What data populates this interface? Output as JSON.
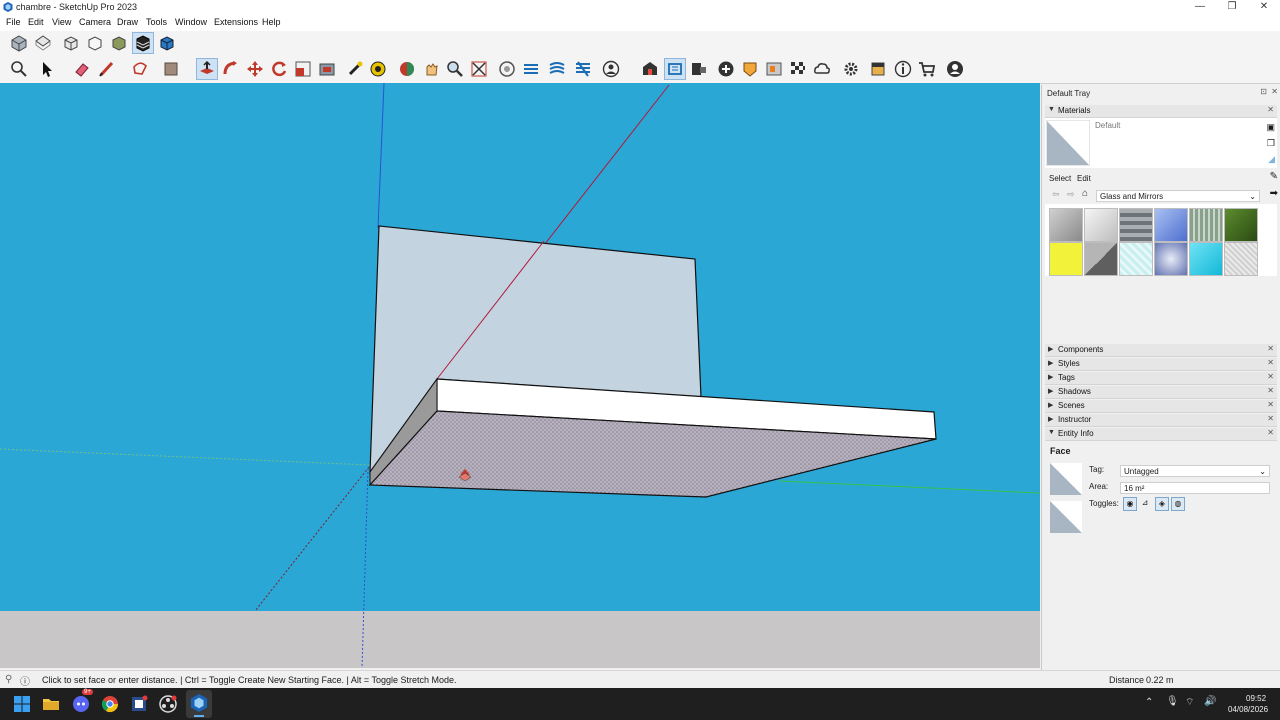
{
  "window": {
    "title": "chambre - SketchUp Pro 2023",
    "icon": "sketchup-icon",
    "controls": {
      "minimize": "—",
      "restore": "❐",
      "close": "✕"
    }
  },
  "menu": [
    "File",
    "Edit",
    "View",
    "Camera",
    "Draw",
    "Tools",
    "Window",
    "Extensions",
    "Help"
  ],
  "toolbar1": [
    "iso-view-icon",
    "top-view-icon",
    "front-view-icon",
    "right-view-icon",
    "back-view-icon",
    "left-view-icon",
    "bottom-view-icon"
  ],
  "toolbar2": [
    "zoom-extents-icon",
    "select-icon",
    "eraser-icon",
    "line-icon",
    "shapes-icon",
    "paint-bucket-icon",
    "push-pull-icon",
    "follow-me-icon",
    "move-icon",
    "rotate-icon",
    "scale-icon",
    "offset-icon",
    "tape-measure-icon",
    "protractor-icon",
    "orbit-icon",
    "pan-icon",
    "zoom-icon",
    "zoom-window-icon",
    "section-plane-icon",
    "display-section-icon",
    "section-fill-icon",
    "layers-icon",
    "user-icon",
    "warehouse-icon",
    "extension-manager-icon",
    "outliner-icon",
    "add-location-icon",
    "sandbox-icon",
    "texture-icon",
    "checker-icon",
    "cloud-icon",
    "settings-icon",
    "tray-icon",
    "info-icon",
    "cart-icon",
    "account-icon"
  ],
  "tray": {
    "title": "Default Tray",
    "materials": {
      "label": "Materials",
      "current": "Default",
      "tabs": {
        "select": "Select",
        "edit": "Edit"
      },
      "library": "Glass and Mirrors",
      "swatch_colors": [
        "#9a9a9a",
        "#d8d8d8",
        "#6d7378",
        "#7a9ae0",
        "#88a08c",
        "#3d6a1e",
        "#f2f23a",
        "#7d7d7d",
        "#c8eef0",
        "#8895c8",
        "#3fd2ec",
        "#c8c8c8"
      ]
    },
    "panels": [
      "Components",
      "Styles",
      "Tags",
      "Shadows",
      "Scenes",
      "Instructor",
      "Entity Info"
    ],
    "entity_info": {
      "type": "Face",
      "tag_label": "Tag:",
      "tag_value": "Untagged",
      "area_label": "Area:",
      "area_value": "16 m²",
      "toggles_label": "Toggles:"
    }
  },
  "statusbar": {
    "message": "Click to set face or enter distance. | Ctrl = Toggle Create New Starting Face. | Alt = Toggle Stretch Mode.",
    "measure_label": "Distance",
    "measure_value": "0.22 m"
  },
  "taskbar": {
    "apps": [
      "windows-start-icon",
      "file-explorer-icon",
      "discord-icon",
      "chrome-icon",
      "app-icon",
      "obs-icon",
      "sketchup-taskbar-icon"
    ],
    "discord_badge": "9+",
    "time": "09:52",
    "date": "04/08/2026"
  },
  "colors": {
    "sky": "#2ba7d6",
    "ground": "#c9c6c8",
    "accent": "#8fb6dc"
  }
}
